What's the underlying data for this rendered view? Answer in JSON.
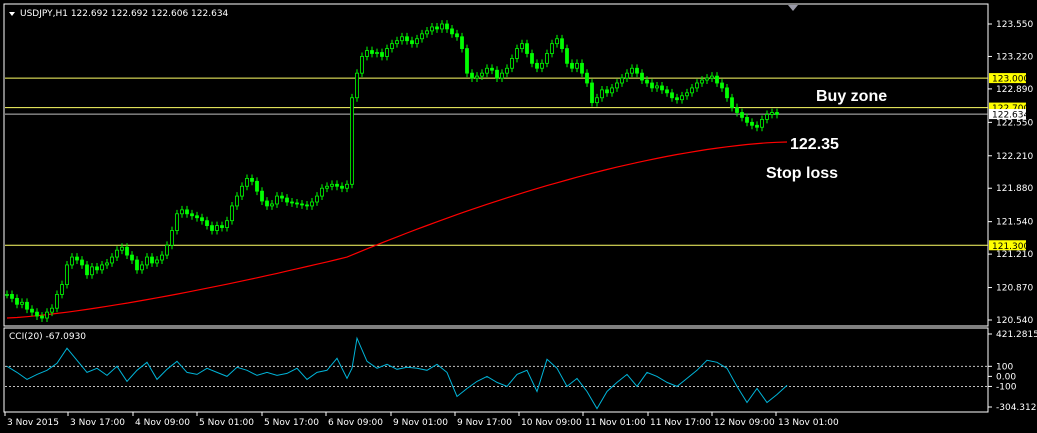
{
  "header": {
    "menu_icon": "triangle-down-icon",
    "title": "USDJPY,H1  122.692 122.692 122.606 122.634"
  },
  "indicator": {
    "title": "CCI(20) -67.0930",
    "scale_labels": [
      "421.2815",
      "100",
      "0.00",
      "-100",
      "-304.3123"
    ]
  },
  "annotations": {
    "buy_zone": "Buy zone",
    "stop_price": "122.35",
    "stop_loss": "Stop loss"
  },
  "colors": {
    "background": "#000000",
    "candle": "#00ff00",
    "ma": "#ff0000",
    "level_line": "#ffff66",
    "cci_line": "#00b4d8",
    "cci_level": "#c0c0c0",
    "frame": "#ffffff"
  },
  "chart_data": {
    "type": "line",
    "symbol": "USDJPY",
    "timeframe": "H1",
    "price_ticks": [
      "123.550",
      "123.220",
      "122.890",
      "122.550",
      "122.210",
      "121.880",
      "121.540",
      "121.210",
      "120.870",
      "120.540"
    ],
    "x_ticks": [
      "3 Nov 2015",
      "3 Nov 17:00",
      "4 Nov 09:00",
      "5 Nov 01:00",
      "5 Nov 17:00",
      "6 Nov 09:00",
      "9 Nov 01:00",
      "9 Nov 17:00",
      "10 Nov 09:00",
      "11 Nov 01:00",
      "11 Nov 17:00",
      "12 Nov 09:00",
      "13 Nov 01:00"
    ],
    "horizontal_levels": [
      {
        "label": "123.000",
        "value": 123.0
      },
      {
        "label": "122.700",
        "value": 122.7
      },
      {
        "value": 122.634
      },
      {
        "label": "121.300",
        "value": 121.3
      }
    ],
    "current_price": {
      "label": "122.634",
      "value": 122.634
    },
    "close_series": {
      "x": [
        0,
        5,
        10,
        15,
        20,
        25,
        30,
        35,
        40,
        45,
        50,
        55,
        60,
        65,
        70,
        75,
        80,
        85,
        90,
        95,
        100,
        105,
        110,
        115,
        120,
        125,
        130,
        135,
        140,
        145,
        150,
        155,
        160,
        165,
        170,
        175,
        180,
        185,
        190,
        195,
        200,
        205,
        210,
        215,
        220,
        225,
        230,
        235,
        240,
        245,
        250,
        255,
        260,
        265,
        270,
        275,
        280,
        285,
        290,
        295,
        300,
        305,
        310,
        315,
        320,
        325,
        330,
        335,
        340,
        345,
        350,
        355,
        360,
        365,
        370,
        375,
        380,
        385,
        390,
        395,
        400,
        405,
        410,
        415,
        420,
        425,
        430,
        435,
        440,
        445,
        450,
        455,
        460,
        465,
        470,
        475,
        480,
        485,
        490,
        495,
        500,
        505,
        510,
        515,
        520,
        525,
        530,
        535,
        540,
        545,
        550,
        555,
        560,
        565,
        570,
        575,
        580,
        585,
        590,
        595,
        600,
        605,
        610,
        615,
        620,
        625,
        630,
        635,
        640,
        645,
        650,
        655,
        660,
        665,
        670,
        675,
        680,
        685,
        690,
        695,
        700,
        705,
        710,
        715,
        720,
        725,
        730,
        735,
        740,
        745,
        750,
        755,
        760,
        765,
        770,
        775,
        780
      ],
      "y": [
        120.8,
        120.76,
        120.7,
        120.72,
        120.65,
        120.62,
        120.58,
        120.56,
        120.62,
        120.66,
        120.8,
        120.9,
        121.1,
        121.18,
        121.15,
        121.1,
        121.0,
        121.08,
        121.05,
        121.1,
        121.12,
        121.18,
        121.25,
        121.28,
        121.2,
        121.15,
        121.05,
        121.1,
        121.18,
        121.12,
        121.15,
        121.2,
        121.3,
        121.45,
        121.62,
        121.66,
        121.62,
        121.6,
        121.58,
        121.55,
        121.5,
        121.45,
        121.5,
        121.48,
        121.55,
        121.7,
        121.8,
        121.9,
        121.98,
        121.95,
        121.85,
        121.75,
        121.7,
        121.72,
        121.8,
        121.78,
        121.74,
        121.73,
        121.72,
        121.71,
        121.7,
        121.74,
        121.8,
        121.88,
        121.9,
        121.92,
        121.9,
        121.88,
        121.92,
        122.8,
        123.05,
        123.22,
        123.28,
        123.25,
        123.26,
        123.22,
        123.3,
        123.35,
        123.38,
        123.42,
        123.38,
        123.35,
        123.4,
        123.45,
        123.48,
        123.52,
        123.5,
        123.55,
        123.5,
        123.45,
        123.42,
        123.3,
        123.05,
        123.0,
        123.02,
        123.05,
        123.1,
        123.08,
        123.0,
        123.05,
        123.1,
        123.2,
        123.3,
        123.35,
        123.25,
        123.15,
        123.1,
        123.15,
        123.25,
        123.35,
        123.4,
        123.3,
        123.15,
        123.1,
        123.15,
        123.05,
        122.95,
        122.75,
        122.8,
        122.88,
        122.85,
        122.9,
        122.95,
        123.0,
        123.05,
        123.1,
        123.05,
        122.98,
        122.95,
        122.9,
        122.92,
        122.88,
        122.85,
        122.8,
        122.78,
        122.82,
        122.85,
        122.9,
        122.95,
        122.98,
        123.0,
        123.02,
        122.95,
        122.9,
        122.8,
        122.7,
        122.65,
        122.6,
        122.55,
        122.52,
        122.5,
        122.58,
        122.63,
        122.65,
        122.63
      ]
    },
    "ma_series": {
      "x": [
        0,
        340,
        780
      ],
      "y": [
        120.56,
        121.18,
        122.35
      ]
    },
    "cci_series": {
      "x": [
        0,
        10,
        20,
        30,
        40,
        50,
        60,
        70,
        80,
        90,
        100,
        110,
        120,
        130,
        140,
        150,
        160,
        170,
        180,
        190,
        200,
        210,
        220,
        230,
        240,
        250,
        260,
        270,
        280,
        290,
        300,
        310,
        320,
        330,
        340,
        345,
        350,
        360,
        370,
        380,
        390,
        400,
        410,
        420,
        430,
        440,
        450,
        460,
        470,
        480,
        490,
        500,
        510,
        520,
        530,
        540,
        550,
        560,
        570,
        580,
        590,
        600,
        610,
        620,
        630,
        640,
        650,
        660,
        670,
        680,
        690,
        700,
        710,
        720,
        730,
        740,
        750,
        760,
        770,
        780
      ],
      "y": [
        100,
        40,
        -30,
        20,
        60,
        130,
        280,
        160,
        40,
        80,
        10,
        100,
        -50,
        60,
        140,
        -30,
        70,
        150,
        40,
        20,
        80,
        40,
        0,
        90,
        60,
        10,
        40,
        10,
        30,
        80,
        -30,
        40,
        60,
        180,
        -20,
        80,
        380,
        150,
        80,
        120,
        70,
        90,
        80,
        60,
        120,
        40,
        -200,
        -120,
        -50,
        0,
        -60,
        -100,
        20,
        60,
        -150,
        170,
        80,
        -100,
        -20,
        -150,
        -320,
        -150,
        -60,
        20,
        -100,
        40,
        0,
        -60,
        -100,
        -20,
        60,
        160,
        140,
        80,
        -100,
        -260,
        -120,
        -260,
        -180,
        -90
      ]
    },
    "stop_loss": 122.35,
    "buy_zone_range": [
      122.634,
      123.0
    ]
  }
}
